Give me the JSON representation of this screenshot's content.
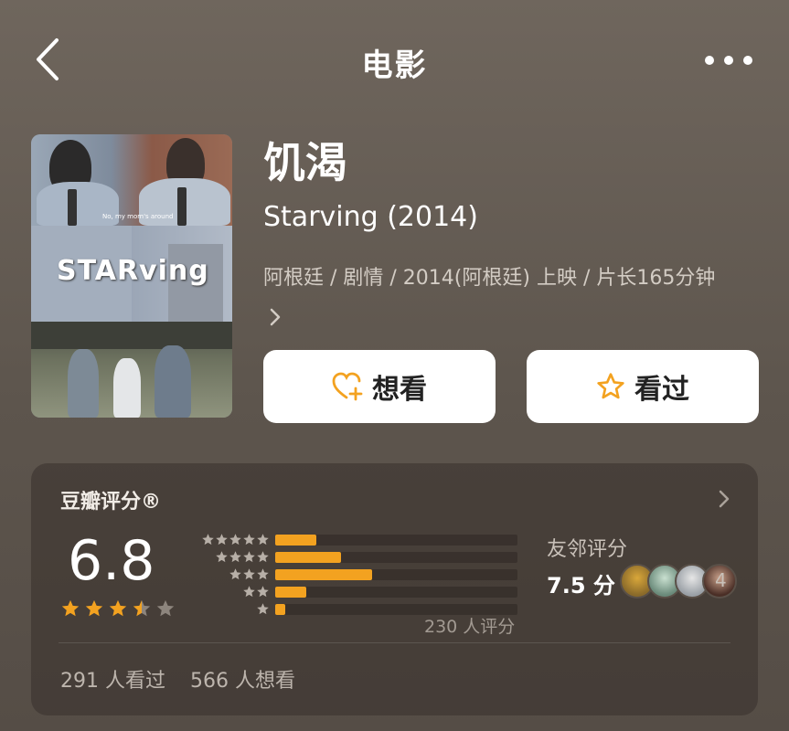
{
  "header": {
    "title": "电影"
  },
  "poster": {
    "caption": "No, my mom's around",
    "logo_text": "STARving"
  },
  "movie": {
    "title_zh": "饥渴",
    "title_en": "Starving (2014)",
    "meta": "阿根廷 / 剧情 / 2014(阿根廷) 上映 / 片长165分钟"
  },
  "actions": {
    "want_label": "想看",
    "seen_label": "看过"
  },
  "rating": {
    "label": "豆瓣评分®",
    "score": "6.8",
    "stars": 3.5,
    "distribution": [
      {
        "stars": 5,
        "fraction": 0.17
      },
      {
        "stars": 4,
        "fraction": 0.27
      },
      {
        "stars": 3,
        "fraction": 0.4
      },
      {
        "stars": 2,
        "fraction": 0.13
      },
      {
        "stars": 1,
        "fraction": 0.04
      }
    ],
    "count_text": "230 人评分",
    "friends_label": "友邻评分",
    "friends_score": "7.5 分",
    "friends_count": "4",
    "seen_text": "291 人看过",
    "want_text": "566 人想看"
  },
  "colors": {
    "accent": "#f3a220",
    "star_empty": "#8d857d",
    "background": "#665e56"
  }
}
